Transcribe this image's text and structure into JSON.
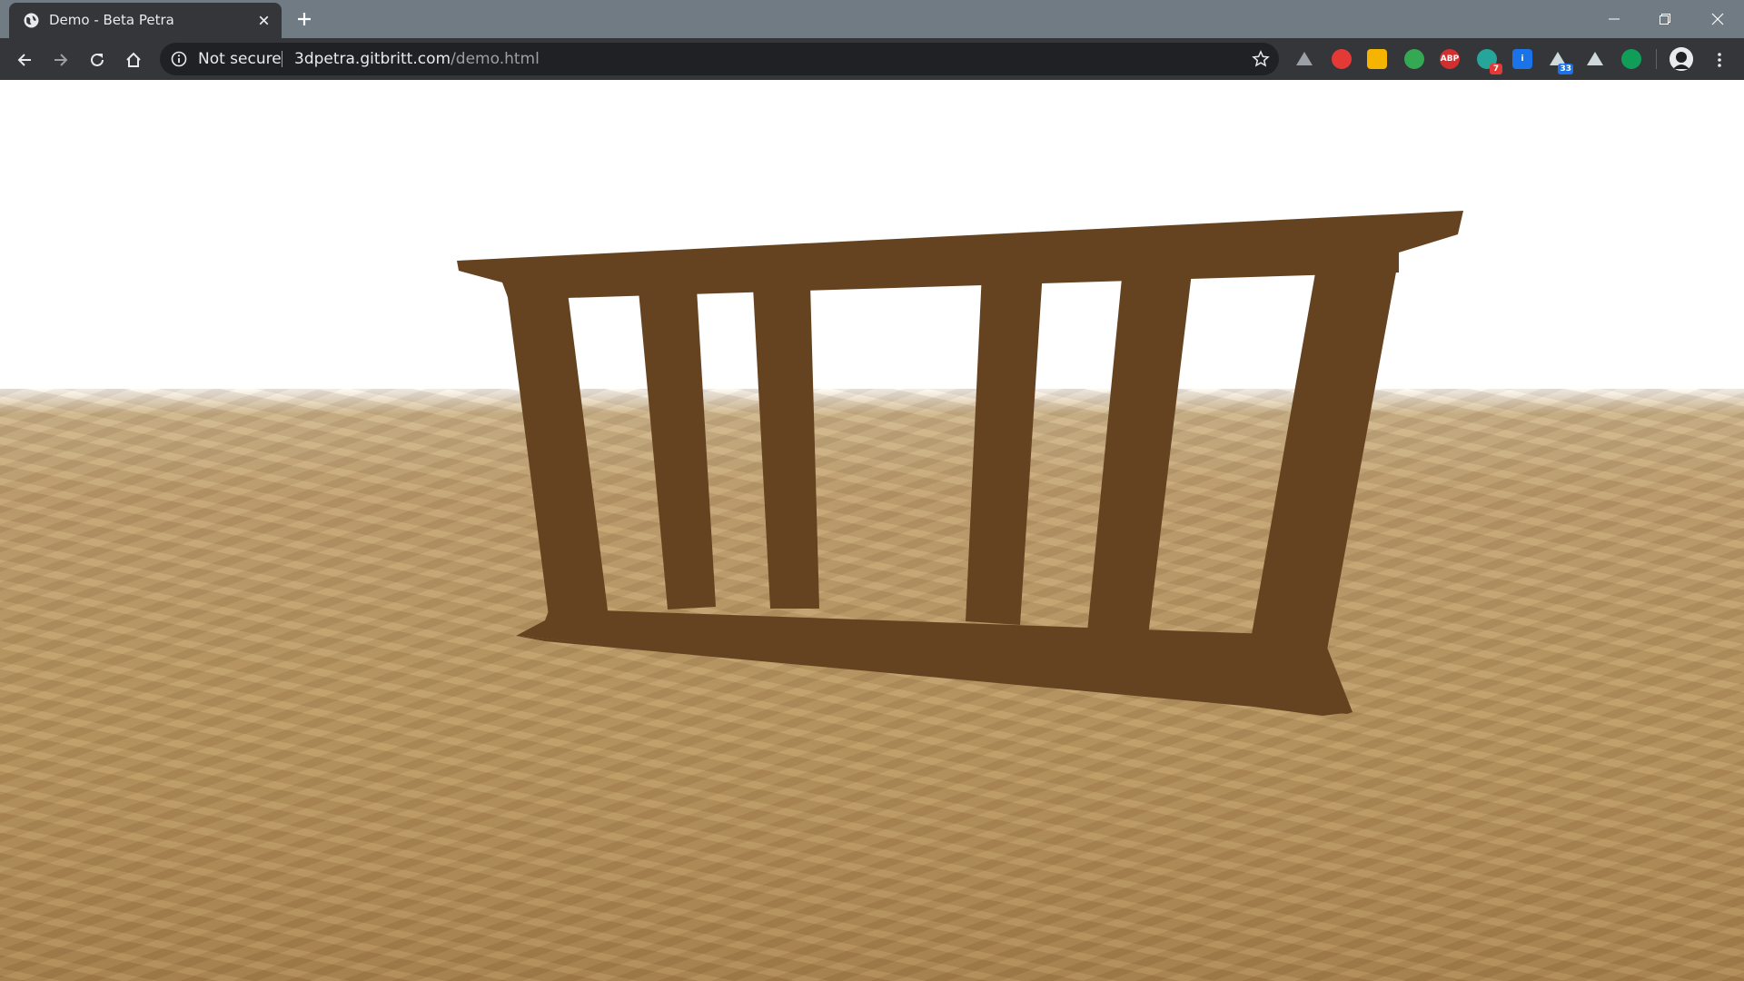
{
  "browser": {
    "tab": {
      "title": "Demo - Beta Petra",
      "favicon": "globe-icon"
    },
    "address": {
      "security_label": "Not secure",
      "url_host": "3dpetra.gitbritt.com",
      "url_path": "/demo.html"
    },
    "extensions": [
      {
        "name": "google-drive-icon",
        "color": "#9aa0a6"
      },
      {
        "name": "hand-extension-icon",
        "color": "#e53935"
      },
      {
        "name": "yellow-extension-icon",
        "color": "#f4b400"
      },
      {
        "name": "green-extension-icon",
        "color": "#34a853"
      },
      {
        "name": "adblock-plus-icon",
        "color": "#d32f2f",
        "label": "ABP"
      },
      {
        "name": "teal-extension-icon",
        "color": "#26a69a",
        "badge": "7"
      },
      {
        "name": "info-extension-icon",
        "color": "#1a73e8",
        "label": "i"
      },
      {
        "name": "cloud-extension-icon",
        "color": "#cfd8dc",
        "badge": "33"
      },
      {
        "name": "diamond-extension-icon",
        "color": "#cfd8dc"
      },
      {
        "name": "green-dot-extension-icon",
        "color": "#0f9d58"
      }
    ]
  },
  "scene": {
    "sky_color": "#ffffff",
    "ground_color": "#b8955f",
    "railing_color": "#654321"
  }
}
